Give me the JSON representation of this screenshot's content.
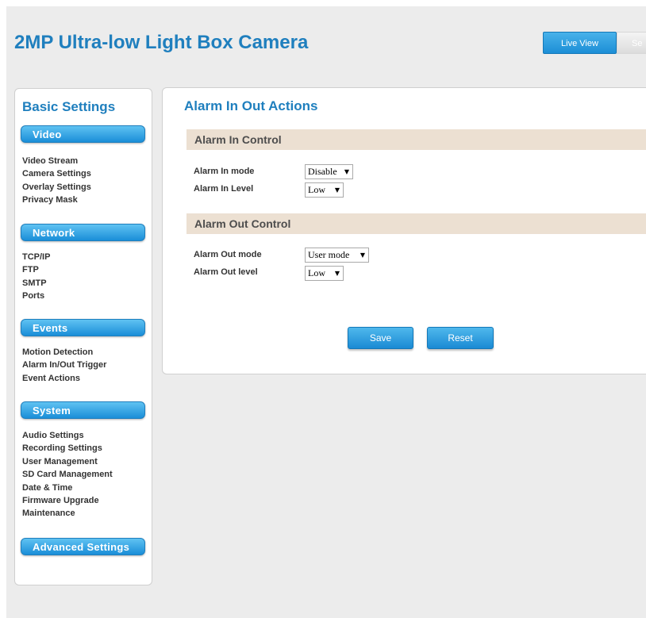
{
  "header": {
    "title": "2MP Ultra-low Light Box Camera",
    "tabs": [
      {
        "label": "Live View",
        "active": true
      },
      {
        "label": "Se",
        "active": false
      }
    ]
  },
  "sidebar": {
    "title": "Basic Settings",
    "sections": [
      {
        "label": "Video",
        "items": [
          "Video Stream",
          "Camera Settings",
          "Overlay Settings",
          "Privacy Mask"
        ]
      },
      {
        "label": "Network",
        "items": [
          "TCP/IP",
          "FTP",
          "SMTP",
          "Ports"
        ]
      },
      {
        "label": "Events",
        "items": [
          "Motion Detection",
          "Alarm In/Out Trigger",
          "Event Actions"
        ]
      },
      {
        "label": "System",
        "items": [
          "Audio Settings",
          "Recording Settings",
          "User Management",
          "SD Card Management",
          "Date & Time",
          "Firmware Upgrade",
          "Maintenance"
        ]
      }
    ],
    "advanced_label": "Advanced Settings"
  },
  "main": {
    "title": "Alarm In Out Actions",
    "alarm_in": {
      "header": "Alarm In Control",
      "mode_label": "Alarm In mode",
      "mode_value": "Disable",
      "level_label": "Alarm In Level",
      "level_value": "Low"
    },
    "alarm_out": {
      "header": "Alarm Out Control",
      "mode_label": "Alarm Out mode",
      "mode_value": "User mode",
      "level_label": "Alarm Out level",
      "level_value": "Low"
    },
    "save_label": "Save",
    "reset_label": "Reset"
  },
  "colors": {
    "accent": "#1f7fbe",
    "button_gradient_top": "#5fc2f2",
    "button_gradient_bottom": "#1a8ed8",
    "group_header_bg": "#ece0d2",
    "page_bg": "#ececec"
  },
  "icons": {
    "dropdown": "triangle-down"
  }
}
